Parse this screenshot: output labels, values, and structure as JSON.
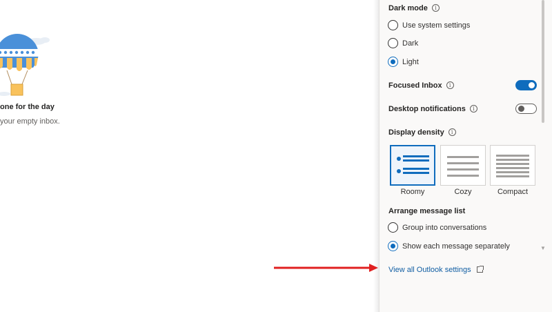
{
  "empty_state": {
    "title": "one for the day",
    "subtitle": "your empty inbox."
  },
  "settings": {
    "dark_mode": {
      "label": "Dark mode",
      "options": [
        {
          "label": "Use system settings",
          "checked": false
        },
        {
          "label": "Dark",
          "checked": false
        },
        {
          "label": "Light",
          "checked": true
        }
      ]
    },
    "focused_inbox": {
      "label": "Focused Inbox",
      "on": true
    },
    "desktop_notifications": {
      "label": "Desktop notifications",
      "on": false
    },
    "display_density": {
      "label": "Display density",
      "options": [
        {
          "label": "Roomy",
          "selected": true
        },
        {
          "label": "Cozy",
          "selected": false
        },
        {
          "label": "Compact",
          "selected": false
        }
      ]
    },
    "arrange_message_list": {
      "label": "Arrange message list",
      "options": [
        {
          "label": "Group into conversations",
          "checked": false
        },
        {
          "label": "Show each message separately",
          "checked": true
        }
      ]
    },
    "view_all_link": "View all Outlook settings"
  },
  "icons": {
    "info": "info-circle-icon",
    "external": "open-in-new-window-icon"
  },
  "colors": {
    "accent": "#0f6cbd",
    "link": "#115ea3",
    "pane_background": "#faf9f8",
    "annotation_arrow": "#e02020"
  }
}
